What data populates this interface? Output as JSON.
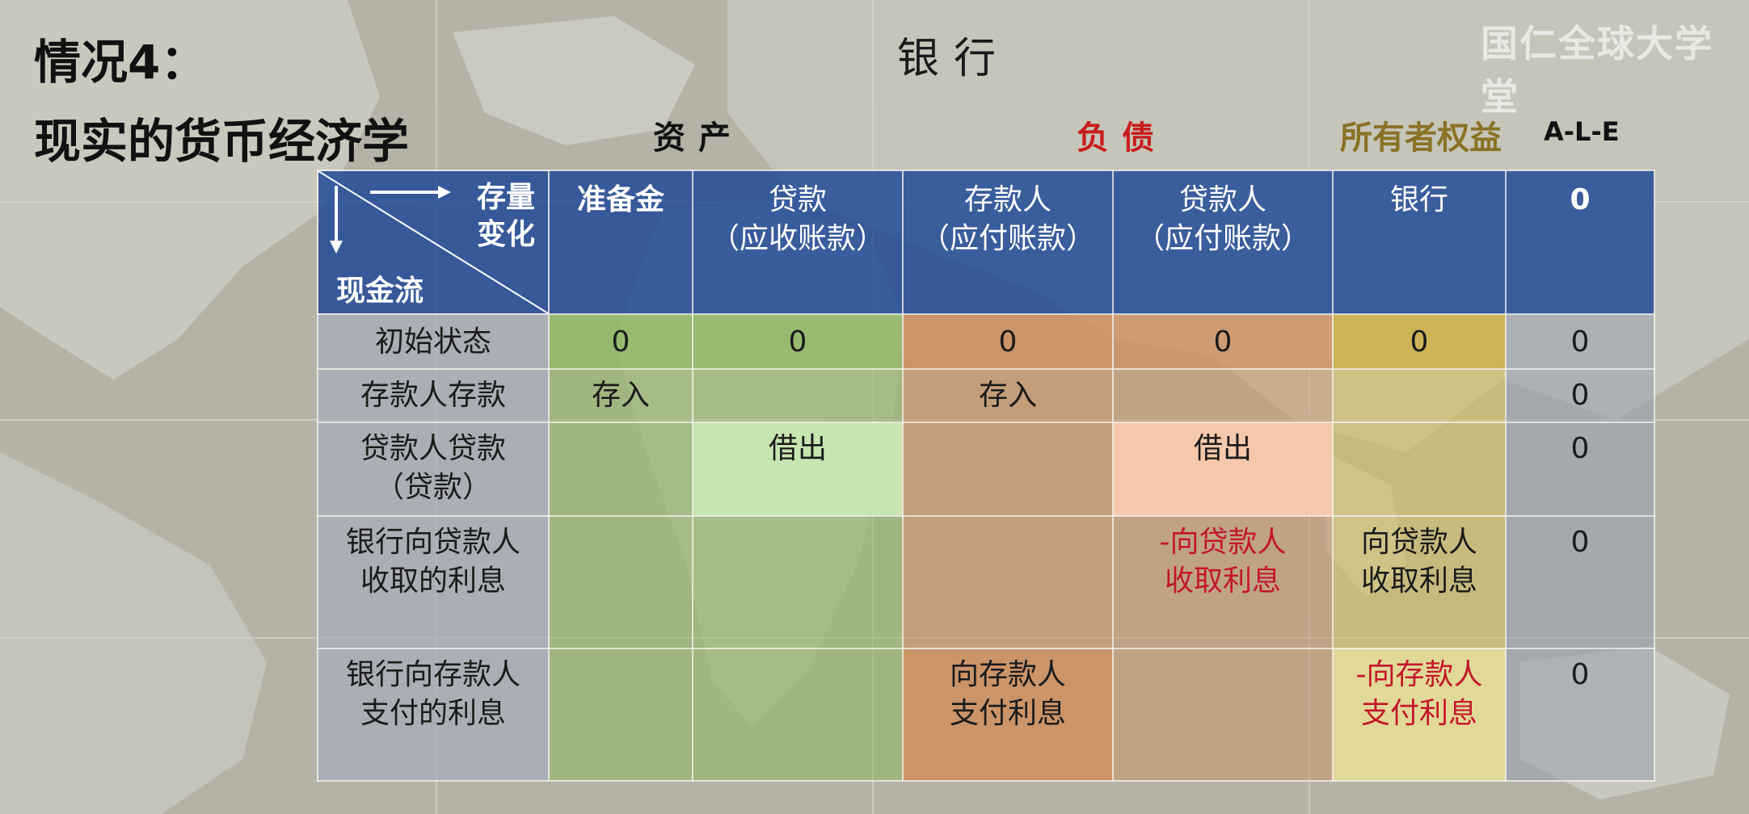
{
  "page": {
    "case_title": "情况4：",
    "main_title": "现实的货币经济学",
    "bank_title": "银行",
    "watermark": "国仁全球大学堂"
  },
  "groups": {
    "assets": "资产",
    "liabilities": "负债",
    "equity": "所有者权益",
    "check": "A-L-E"
  },
  "colors": {
    "header_blue": "#1b4696",
    "assets_green": "#8fb860",
    "liabilities_orange": "#cf8e5e",
    "equity_yellow": "#d6c05c",
    "red_text": "#c2182a",
    "highlight_green": "#c7e5b1",
    "highlight_salmon": "#f6c8ab"
  },
  "table": {
    "corner": {
      "stock_change": "存量\n变化",
      "cash_flow": "现金流",
      "right_arrow_icon": "arrow-right",
      "down_arrow_icon": "arrow-down"
    },
    "columns": [
      "准备金",
      "贷款\n（应收账款）",
      "存款人\n（应付账款）",
      "贷款人\n（应付账款）",
      "银行",
      "0"
    ],
    "rows": [
      {
        "label": "初始状态",
        "cells": [
          "0",
          "0",
          "0",
          "0",
          "0",
          "0"
        ]
      },
      {
        "label": "存款人存款",
        "cells": [
          "存入",
          "",
          "存入",
          "",
          "",
          "0"
        ]
      },
      {
        "label": "贷款人贷款\n（贷款）",
        "cells": [
          "",
          "借出",
          "",
          "借出",
          "",
          "0"
        ]
      },
      {
        "label": "银行向贷款人\n收取的利息",
        "cells": [
          "",
          "",
          "",
          "-向贷款人\n收取利息",
          "向贷款人\n收取利息",
          "0"
        ]
      },
      {
        "label": "银行向存款人\n支付的利息",
        "cells": [
          "",
          "",
          "向存款人\n支付利息",
          "",
          "-向存款人\n支付利息",
          "0"
        ]
      }
    ]
  }
}
